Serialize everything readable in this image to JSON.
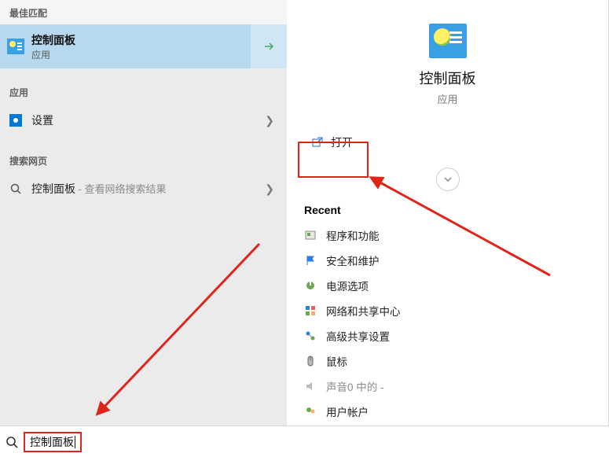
{
  "left": {
    "best_match_header": "最佳匹配",
    "best_match": {
      "title": "控制面板",
      "sub": "应用"
    },
    "apps_header": "应用",
    "settings_label": "设置",
    "web_header": "搜索网页",
    "web_item_label": "控制面板",
    "web_item_sub": " - 查看网络搜索结果"
  },
  "right": {
    "title": "控制面板",
    "sub": "应用",
    "open_label": "打开",
    "recent_header": "Recent",
    "recent": [
      "程序和功能",
      "安全和维护",
      "电源选项",
      "网络和共享中心",
      "高级共享设置",
      "鼠标",
      "声音0 中的 -",
      "用户帐户"
    ]
  },
  "search": {
    "value": "控制面板"
  }
}
